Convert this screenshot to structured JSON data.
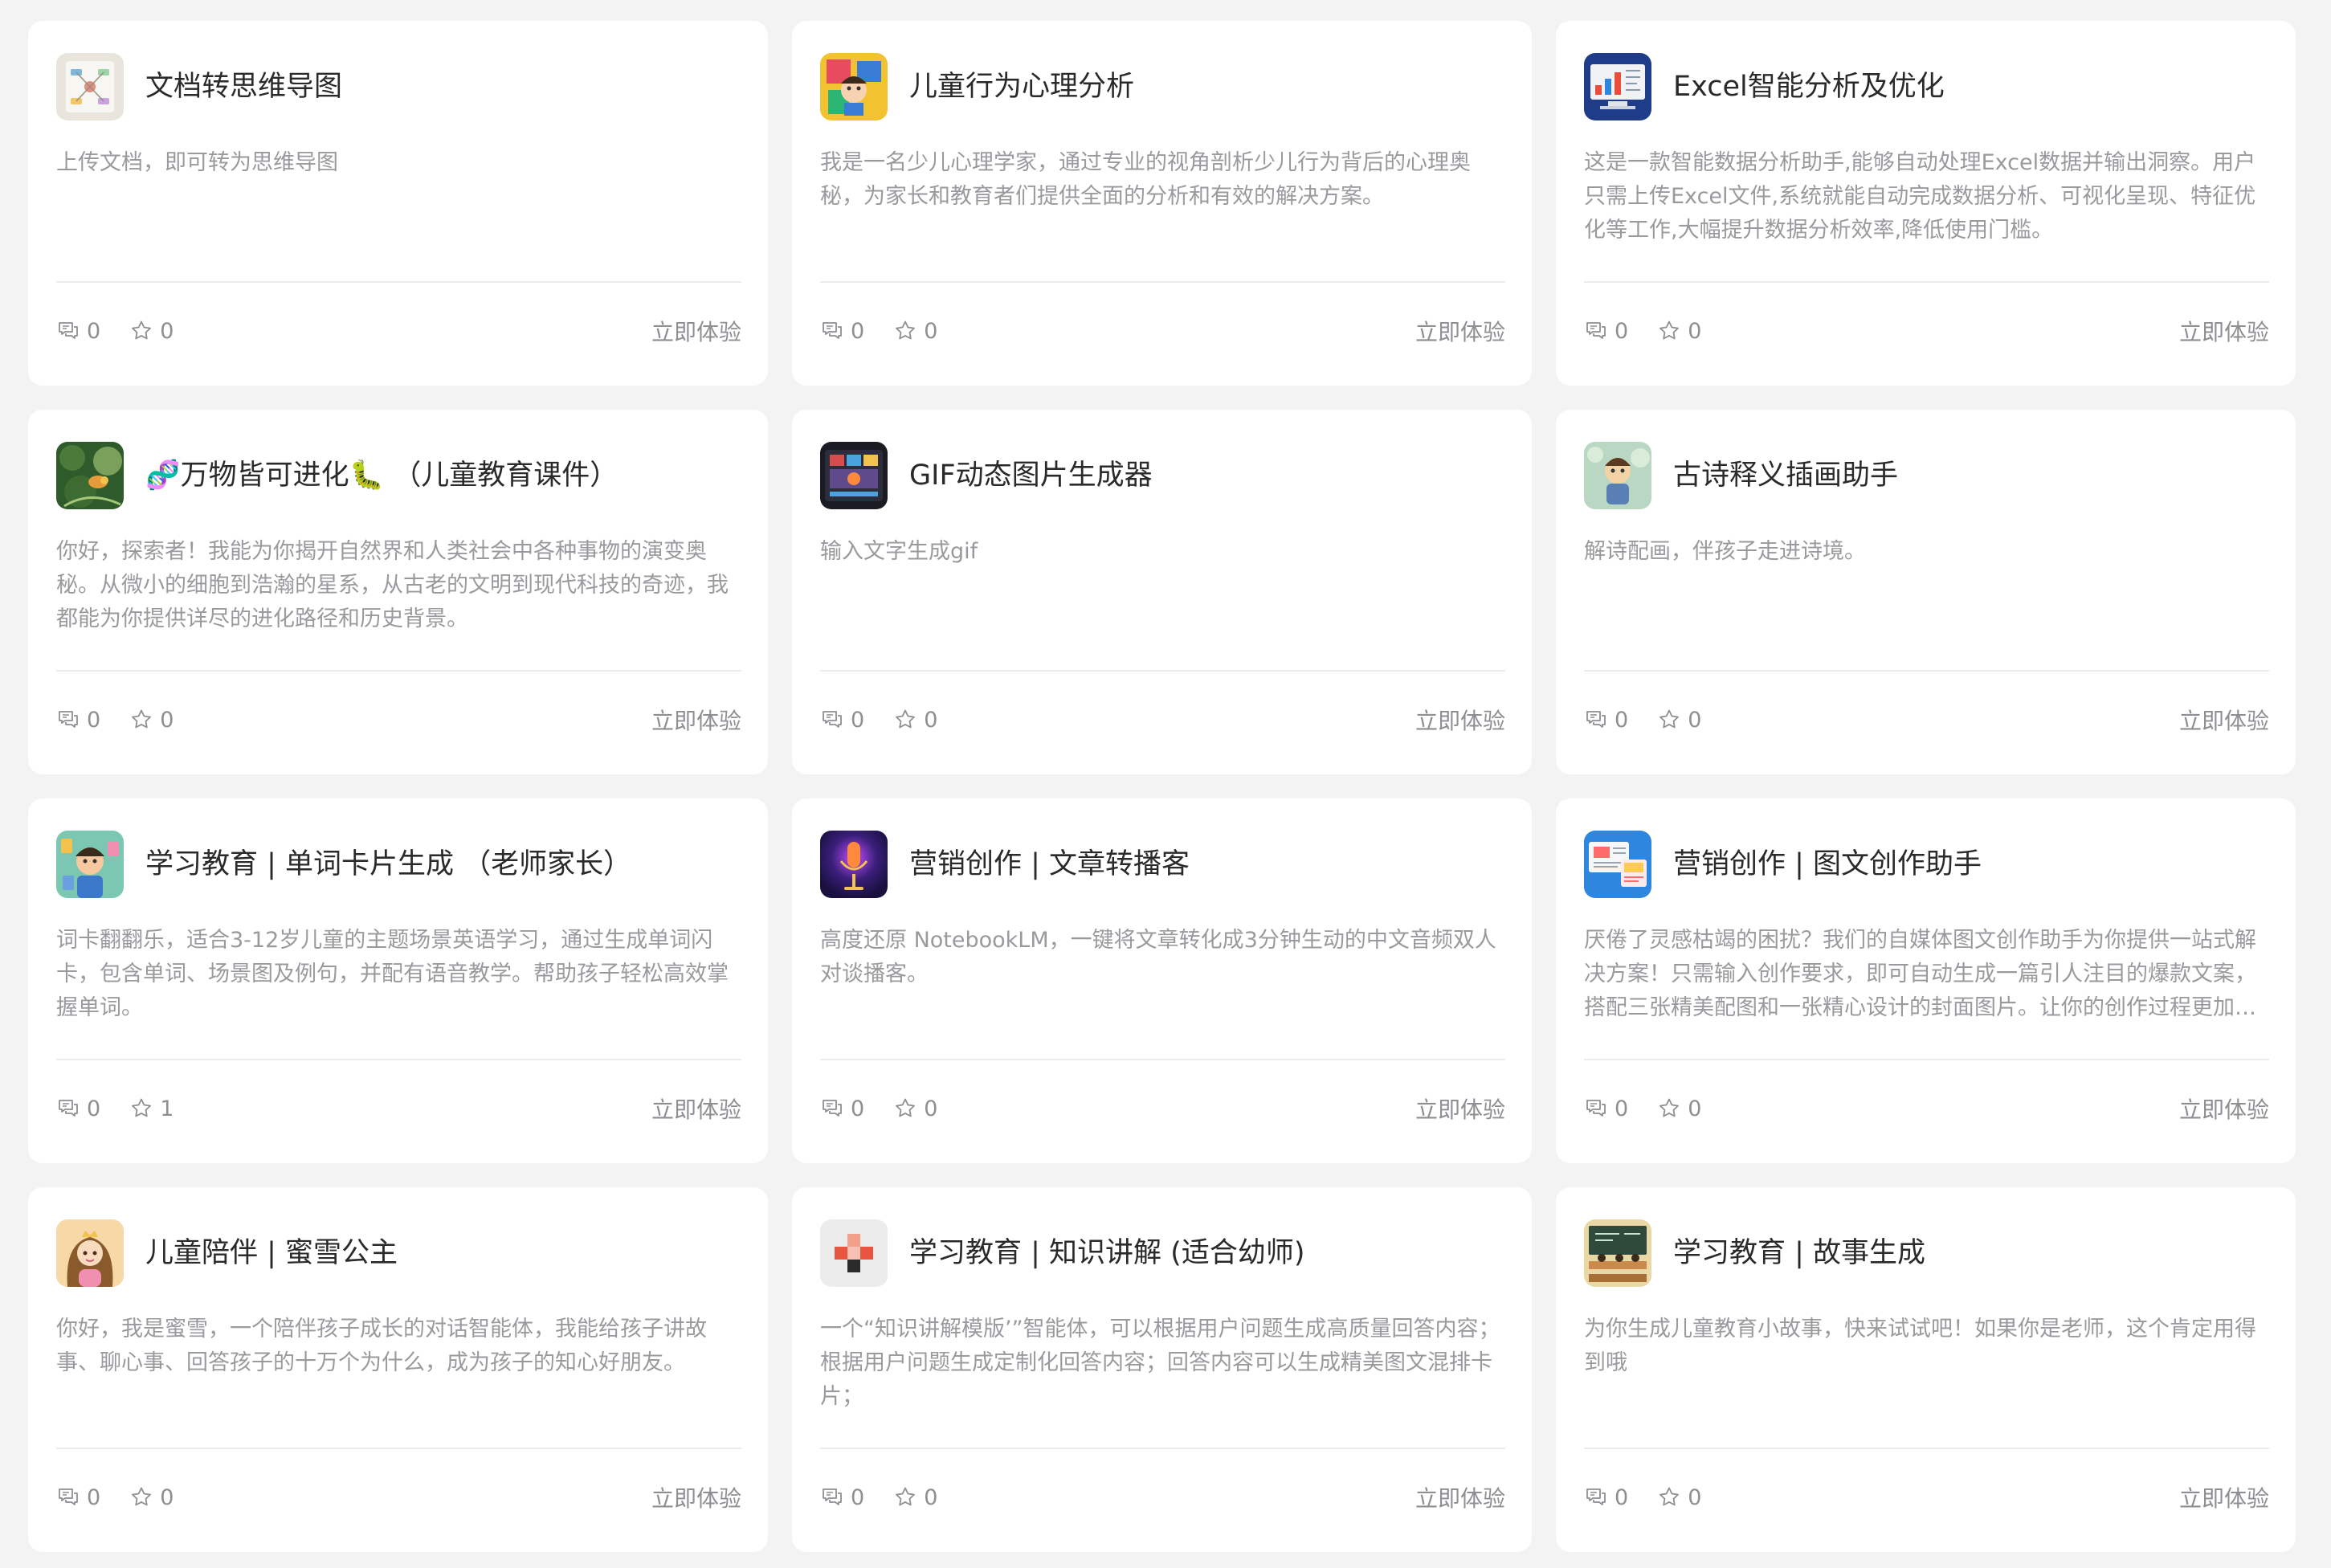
{
  "cta_label": "立即体验",
  "cards": [
    {
      "title": "文档转思维导图",
      "description": "上传文档，即可转为思维导图",
      "comments": "0",
      "stars": "0",
      "icon": "mindmap-doc-icon",
      "icon_colors": [
        "#e9e4dc",
        "#7fb7d8",
        "#e28f7d"
      ]
    },
    {
      "title": "儿童行为心理分析",
      "description": "我是一名少儿心理学家，通过专业的视角剖析少儿行为背后的心理奥秘，为家长和教育者们提供全面的分析和有效的解决方案。",
      "comments": "0",
      "stars": "0",
      "icon": "child-psychology-icon",
      "icon_colors": [
        "#f2c230",
        "#3a7bd5",
        "#e84a5f"
      ]
    },
    {
      "title": "Excel智能分析及优化",
      "description": "这是一款智能数据分析助手,能够自动处理Excel数据并输出洞察。用户只需上传Excel文件,系统就能自动完成数据分析、可视化呈现、特征优化等工作,大幅提升数据分析效率,降低使用门槛。",
      "comments": "0",
      "stars": "0",
      "icon": "excel-analysis-icon",
      "icon_colors": [
        "#1f3c88",
        "#f0f2f5",
        "#e94e3c"
      ]
    },
    {
      "title": "🧬万物皆可进化🐛 （儿童教育课件）",
      "description": "你好，探索者！我能为你揭开自然界和人类社会中各种事物的演变奥秘。从微小的细胞到浩瀚的星系，从古老的文明到现代科技的奇迹，我都能为你提供详尽的进化路径和历史背景。",
      "comments": "0",
      "stars": "0",
      "icon": "evolution-forest-icon",
      "icon_colors": [
        "#2f5a2a",
        "#7ba05b",
        "#e59b3a"
      ]
    },
    {
      "title": "GIF动态图片生成器",
      "description": "输入文字生成gif",
      "comments": "0",
      "stars": "0",
      "icon": "gif-generator-icon",
      "icon_colors": [
        "#1b1b24",
        "#d64d4d",
        "#4aa3df"
      ]
    },
    {
      "title": "古诗释义插画助手",
      "description": "解诗配画，伴孩子走进诗境。",
      "comments": "0",
      "stars": "0",
      "icon": "poem-illustration-icon",
      "icon_colors": [
        "#b9d7c2",
        "#f3d3a5",
        "#5a7fb5"
      ]
    },
    {
      "title": "学习教育 | 单词卡片生成 （老师家长）",
      "description": "词卡翻翻乐，适合3-12岁儿童的主题场景英语学习，通过生成单词闪卡，包含单词、场景图及例句，并配有语音教学。帮助孩子轻松高效掌握单词。",
      "comments": "0",
      "stars": "1",
      "icon": "word-card-icon",
      "icon_colors": [
        "#7cc7b2",
        "#f6c89f",
        "#3b78c9"
      ]
    },
    {
      "title": "营销创作 | 文章转播客",
      "description": "高度还原 NotebookLM，一键将文章转化成3分钟生动的中文音频双人对谈播客。",
      "comments": "0",
      "stars": "0",
      "icon": "podcast-mic-icon",
      "icon_colors": [
        "#1a1040",
        "#c44dff",
        "#ff8a3d"
      ]
    },
    {
      "title": "营销创作 | 图文创作助手",
      "description": "厌倦了灵感枯竭的困扰？我们的自媒体图文创作助手为你提供一站式解决方案！只需输入创作要求，即可自动生成一篇引人注目的爆款文案，搭配三张精美配图和一张精心设计的封面图片。让你的创作过程更加轻松高效！",
      "comments": "0",
      "stars": "0",
      "icon": "content-creation-icon",
      "icon_colors": [
        "#2e86de",
        "#ff6b6b",
        "#feca57"
      ]
    },
    {
      "title": "儿童陪伴 | 蜜雪公主",
      "description": "你好，我是蜜雪，一个陪伴孩子成长的对话智能体，我能给孩子讲故事、聊心事、回答孩子的十万个为什么，成为孩子的知心好朋友。",
      "comments": "0",
      "stars": "0",
      "icon": "princess-avatar-icon",
      "icon_colors": [
        "#f7d9a8",
        "#8a5a2b",
        "#f08fb0"
      ]
    },
    {
      "title": "学习教育 | 知识讲解 (适合幼师)",
      "description": "一个“知识讲解模版’”智能体，可以根据用户问题生成高质量回答内容；根据用户问题生成定制化回答内容；回答内容可以生成精美图文混排卡片；",
      "comments": "0",
      "stars": "0",
      "icon": "knowledge-blocks-icon",
      "icon_colors": [
        "#ececec",
        "#e8553e",
        "#2b2b2b"
      ]
    },
    {
      "title": "学习教育 | 故事生成",
      "description": "为你生成儿童教育小故事，快来试试吧！如果你是老师，这个肯定用得到哦",
      "comments": "0",
      "stars": "0",
      "icon": "classroom-story-icon",
      "icon_colors": [
        "#2f4a3a",
        "#c98a4b",
        "#e9d8a6"
      ]
    }
  ]
}
